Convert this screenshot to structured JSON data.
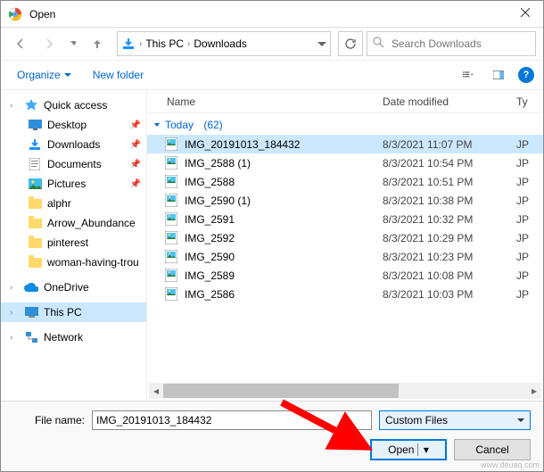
{
  "title": "Open",
  "breadcrumb": {
    "root": "This PC",
    "folder": "Downloads"
  },
  "search": {
    "placeholder": "Search Downloads"
  },
  "toolbar": {
    "organize": "Organize",
    "newfolder": "New folder"
  },
  "tree": {
    "quick_access": "Quick access",
    "desktop": "Desktop",
    "downloads": "Downloads",
    "documents": "Documents",
    "pictures": "Pictures",
    "alphr": "alphr",
    "arrow": "Arrow_Abundance",
    "pinterest": "pinterest",
    "woman": "woman-having-trou",
    "onedrive": "OneDrive",
    "thispc": "This PC",
    "network": "Network"
  },
  "columns": {
    "name": "Name",
    "date": "Date modified",
    "type": "Ty"
  },
  "group": {
    "label": "Today",
    "count": "(62)"
  },
  "files": [
    {
      "name": "IMG_20191013_184432",
      "date": "8/3/2021 11:07 PM",
      "type": "JP",
      "selected": true
    },
    {
      "name": "IMG_2588 (1)",
      "date": "8/3/2021 10:54 PM",
      "type": "JP"
    },
    {
      "name": "IMG_2588",
      "date": "8/3/2021 10:51 PM",
      "type": "JP"
    },
    {
      "name": "IMG_2590 (1)",
      "date": "8/3/2021 10:38 PM",
      "type": "JP"
    },
    {
      "name": "IMG_2591",
      "date": "8/3/2021 10:32 PM",
      "type": "JP"
    },
    {
      "name": "IMG_2592",
      "date": "8/3/2021 10:29 PM",
      "type": "JP"
    },
    {
      "name": "IMG_2590",
      "date": "8/3/2021 10:23 PM",
      "type": "JP"
    },
    {
      "name": "IMG_2589",
      "date": "8/3/2021 10:08 PM",
      "type": "JP"
    },
    {
      "name": "IMG_2586",
      "date": "8/3/2021 10:03 PM",
      "type": "JP"
    }
  ],
  "filename": {
    "label": "File name:",
    "value": "IMG_20191013_184432"
  },
  "filetype": "Custom Files",
  "buttons": {
    "open": "Open",
    "cancel": "Cancel"
  },
  "watermark": "www.deuaq.com"
}
